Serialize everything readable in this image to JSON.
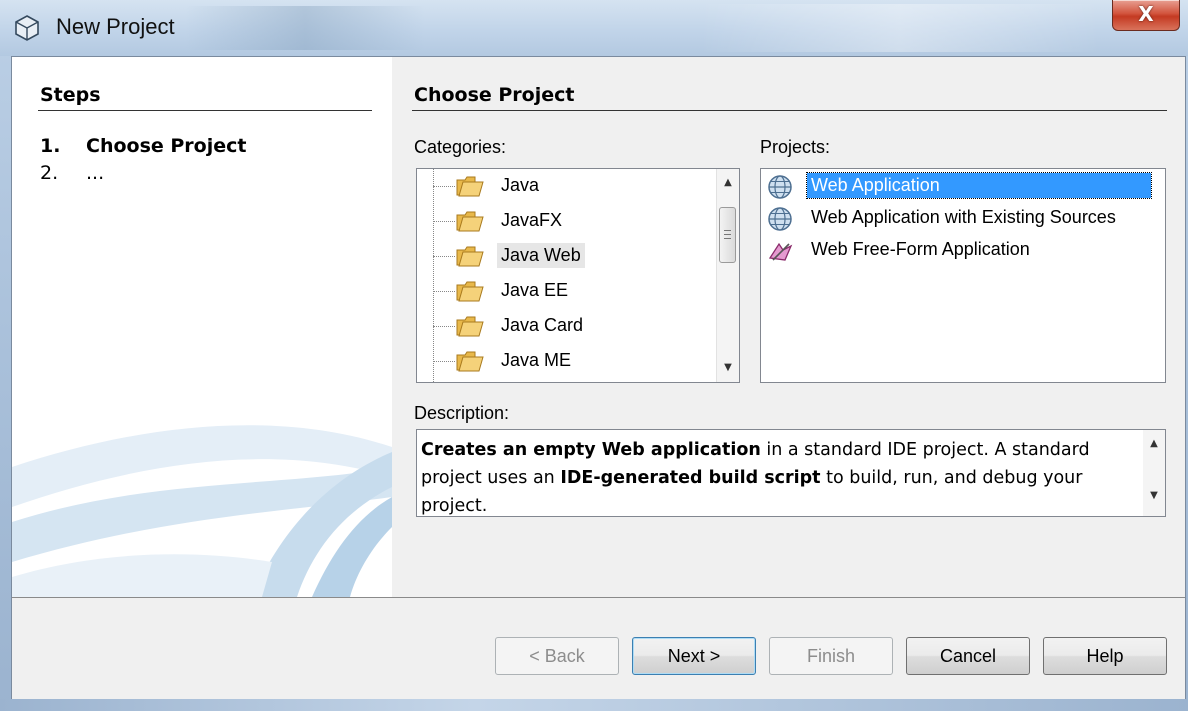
{
  "window": {
    "title": "New Project",
    "close_label": "X"
  },
  "steps": {
    "title": "Steps",
    "items": [
      {
        "num": "1.",
        "label": "Choose Project"
      },
      {
        "num": "2.",
        "label": "..."
      }
    ]
  },
  "content": {
    "title": "Choose Project",
    "categories_label": "Categories:",
    "projects_label": "Projects:",
    "description_label": "Description:"
  },
  "categories": [
    {
      "label": "Java",
      "selected": false
    },
    {
      "label": "JavaFX",
      "selected": false
    },
    {
      "label": "Java Web",
      "selected": true
    },
    {
      "label": "Java EE",
      "selected": false
    },
    {
      "label": "Java Card",
      "selected": false
    },
    {
      "label": "Java ME",
      "selected": false
    }
  ],
  "projects": [
    {
      "label": "Web Application",
      "icon": "globe-icon",
      "selected": true
    },
    {
      "label": "Web Application with Existing Sources",
      "icon": "globe-icon",
      "selected": false
    },
    {
      "label": "Web Free-Form Application",
      "icon": "freeform-icon",
      "selected": false
    }
  ],
  "description": {
    "bold1": "Creates an empty Web application",
    "text1": " in a standard IDE project. A standard project uses an ",
    "bold2": "IDE-generated build script",
    "text2": " to build, run, and debug your project."
  },
  "buttons": {
    "back": "< Back",
    "next": "Next >",
    "finish": "Finish",
    "cancel": "Cancel",
    "help": "Help"
  },
  "colors": {
    "selection": "#3399ff",
    "close": "#c43a22"
  }
}
